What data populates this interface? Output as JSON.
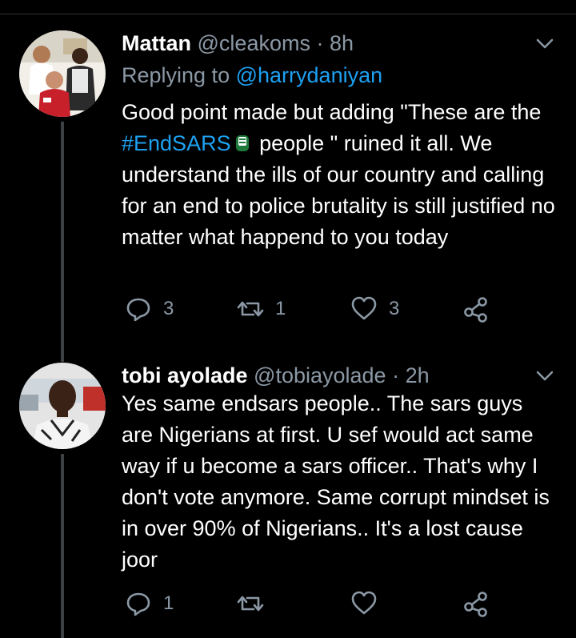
{
  "tweets": [
    {
      "name": "Mattan",
      "handle": "@cleakoms",
      "separator": "·",
      "time": "8h",
      "replying_prefix": "Replying to",
      "replying_to": "@harrydaniyan",
      "text_part1": "Good point made but adding \"These are the ",
      "hashtag": "#EndSARS",
      "text_part2": " people \" ruined it all. We understand the ills of our country and calling for an end to police brutality is still justified no matter what happend to you today",
      "replies": "3",
      "retweets": "1",
      "likes": "3"
    },
    {
      "name": "tobi ayolade",
      "handle": "@tobiayolade",
      "separator": "·",
      "time": "2h",
      "text": "Yes same endsars people.. The sars guys are Nigerians at first. U sef would act same way if u become a sars officer.. That's why I don't vote anymore. Same corrupt mindset is in over 90% of Nigerians.. It's a lost cause joor",
      "replies": "1",
      "retweets": "",
      "likes": ""
    }
  ],
  "colors": {
    "background": "#000000",
    "text": "#ffffff",
    "secondary": "#8b98a5",
    "link": "#1da1f2",
    "thread_line": "#3d4145"
  },
  "icons": [
    "reply-icon",
    "retweet-icon",
    "like-icon",
    "share-icon",
    "chevron-down-icon",
    "endsars-fist-icon"
  ]
}
